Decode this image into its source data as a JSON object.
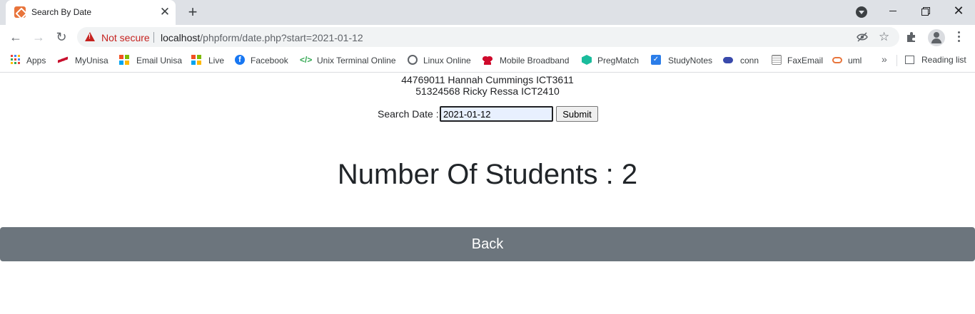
{
  "browser": {
    "tab": {
      "title": "Search By Date",
      "close_glyph": "✕"
    },
    "new_tab_glyph": "+",
    "window_controls": {
      "close_glyph": "✕"
    },
    "nav": {
      "back_glyph": "←",
      "forward_glyph": "→",
      "reload_glyph": "↻"
    },
    "address_bar": {
      "security_label": "Not secure",
      "url_host": "localhost",
      "url_path": "/phpform/date.php?start=2021-01-12"
    },
    "bookmarks": [
      {
        "label": "Apps",
        "icon": "apps-grid-icon"
      },
      {
        "label": "MyUnisa",
        "icon": "myunisa-icon",
        "color": "#c8102e"
      },
      {
        "label": "Email Unisa",
        "icon": "microsoft-icon"
      },
      {
        "label": "Live",
        "icon": "microsoft-icon"
      },
      {
        "label": "Facebook",
        "icon": "facebook-icon",
        "color": "#1877f2"
      },
      {
        "label": "Unix Terminal Online",
        "icon": "code-icon",
        "color": "#34a853"
      },
      {
        "label": "Linux Online",
        "icon": "globe-icon",
        "color": "#5f6368"
      },
      {
        "label": "Mobile Broadband",
        "icon": "huawei-icon",
        "color": "#cf0a2c"
      },
      {
        "label": "PregMatch",
        "icon": "pregmatch-icon",
        "color": "#1abc9c"
      },
      {
        "label": "StudyNotes",
        "icon": "studynotes-icon",
        "color": "#2b7de9"
      },
      {
        "label": "conn",
        "icon": "cloud-icon",
        "color": "#3949ab"
      },
      {
        "label": "FaxEmail",
        "icon": "faxemail-icon",
        "color": "#8a8a8a"
      },
      {
        "label": "uml",
        "icon": "cloud-outline-icon",
        "color": "#e8743b"
      }
    ],
    "more_bookmarks_glyph": "»",
    "reading_list_label": "Reading list"
  },
  "page": {
    "students": [
      "44769011 Hannah Cummings ICT3611",
      "51324568 Ricky Ressa ICT2410"
    ],
    "search": {
      "label": "Search Date :",
      "value": "2021-01-12",
      "submit_label": "Submit"
    },
    "count_heading": "Number Of Students : 2",
    "back_label": "Back",
    "colors": {
      "back_bar": "#6c757d",
      "heading": "#212529"
    }
  }
}
